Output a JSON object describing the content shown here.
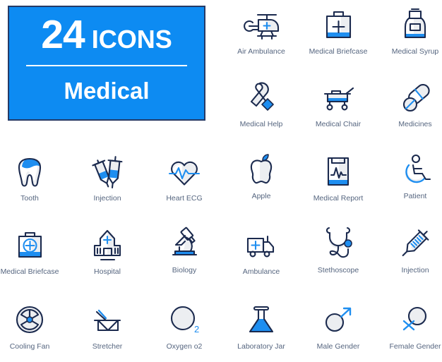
{
  "title_card": {
    "count": "24",
    "word": "ICONS",
    "subtitle": "Medical"
  },
  "colors": {
    "accent_blue": "#0d8bf2",
    "icon_blue": "#1e8ef0",
    "outline_navy": "#1b2a4e",
    "card_border": "#253a66",
    "label_text": "#55657f",
    "shade_grey": "#eceef1",
    "background": "#ffffff"
  },
  "grid": {
    "columns": 6,
    "rows": 5,
    "total_icons": 24
  },
  "icons": [
    {
      "label": "Air Ambulance",
      "icon": "helicopter-icon",
      "row": 1,
      "col": 4
    },
    {
      "label": "Medical Briefcase",
      "icon": "briefcase-cross-icon",
      "row": 1,
      "col": 5
    },
    {
      "label": "Medical Syrup",
      "icon": "syrup-bottle-icon",
      "row": 1,
      "col": 6
    },
    {
      "label": "Medical Help",
      "icon": "awareness-ribbon-icon",
      "row": 2,
      "col": 4
    },
    {
      "label": "Medical Chair",
      "icon": "hospital-trolley-icon",
      "row": 2,
      "col": 5
    },
    {
      "label": "Medicines",
      "icon": "pills-capsule-icon",
      "row": 2,
      "col": 6
    },
    {
      "label": "Tooth",
      "icon": "tooth-icon",
      "row": 3,
      "col": 1
    },
    {
      "label": "Injection",
      "icon": "two-syringes-icon",
      "row": 3,
      "col": 2
    },
    {
      "label": "Heart ECG",
      "icon": "heart-ecg-icon",
      "row": 3,
      "col": 3
    },
    {
      "label": "Apple",
      "icon": "apple-fruit-icon",
      "row": 3,
      "col": 4
    },
    {
      "label": "Medical Report",
      "icon": "clipboard-ecg-icon",
      "row": 3,
      "col": 5
    },
    {
      "label": "Patient",
      "icon": "wheelchair-icon",
      "row": 3,
      "col": 6
    },
    {
      "label": "Medical Briefcase",
      "icon": "briefcase-circle-icon",
      "row": 4,
      "col": 1
    },
    {
      "label": "Hospital",
      "icon": "hospital-building-icon",
      "row": 4,
      "col": 2
    },
    {
      "label": "Biology",
      "icon": "microscope-icon",
      "row": 4,
      "col": 3
    },
    {
      "label": "Ambulance",
      "icon": "ambulance-van-icon",
      "row": 4,
      "col": 4
    },
    {
      "label": "Stethoscope",
      "icon": "stethoscope-icon",
      "row": 4,
      "col": 5
    },
    {
      "label": "Injection",
      "icon": "single-syringe-icon",
      "row": 4,
      "col": 6
    },
    {
      "label": "Cooling Fan",
      "icon": "radiation-symbol-icon",
      "row": 5,
      "col": 1
    },
    {
      "label": "Stretcher",
      "icon": "stretcher-icon",
      "row": 5,
      "col": 2
    },
    {
      "label": "Oxygen o2",
      "icon": "oxygen-sphere-icon",
      "row": 5,
      "col": 3
    },
    {
      "label": "Laboratory Jar",
      "icon": "lab-flask-icon",
      "row": 5,
      "col": 4
    },
    {
      "label": "Male Gender",
      "icon": "male-symbol-icon",
      "row": 5,
      "col": 5
    },
    {
      "label": "Female Gender",
      "icon": "female-symbol-icon",
      "row": 5,
      "col": 6
    }
  ],
  "oxygen_badge": "2"
}
